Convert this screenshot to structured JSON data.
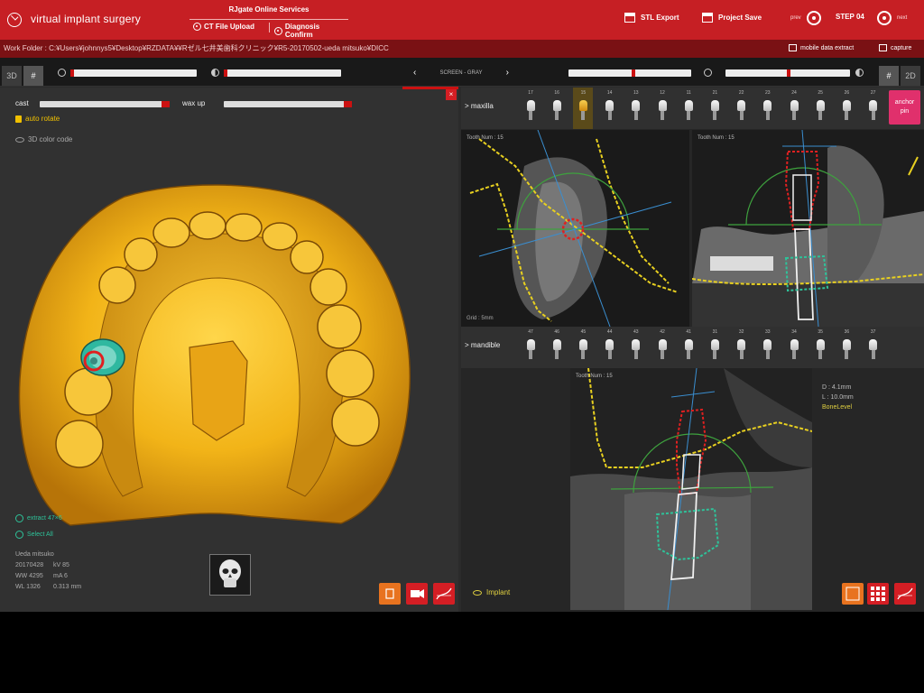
{
  "titlebar": {
    "app_title": "virtual implant surgery",
    "online_services_title": "RJgate Online Services",
    "ct_upload_label": "CT File Upload",
    "diagnosis_label": "Diagnosis Confirm",
    "stl_export_label": "STL Export",
    "project_save_label": "Project Save",
    "prev_label": "prev",
    "step_label": "STEP 04",
    "next_label": "next"
  },
  "workbar": {
    "path": "Work Folder : C:¥Users¥johnnys5¥Desktop¥RZDATA¥¥Rゼル七井美歯科クリニック¥R5-20170502-ueda mitsuko¥DICC",
    "mobile_label": "mobile data extract",
    "capture_label": "capture"
  },
  "toolbar": {
    "tab_3d": "3D",
    "tab_grid": "#",
    "tab_2d": "2D",
    "screen_label": "SCREEN - GRAY",
    "prev_arrow": "‹",
    "next_arrow": "›"
  },
  "left": {
    "cast_label": "cast",
    "wax_label": "wax up",
    "auto_rotate_label": "auto rotate",
    "color_code_label": "3D color code",
    "close_label": "×",
    "legend_1": "extract 47×6",
    "legend_2": "Select All",
    "patient": {
      "name": "Ueda mitsuko",
      "date": "20170428",
      "kv": "kV 85",
      "ww": "WW 4295",
      "ma": "mA 6",
      "wl": "WL 1326",
      "voxel": "0.313 mm"
    }
  },
  "right": {
    "maxilla_label": "> maxilla",
    "mandible_label": "> mandible",
    "anchor_label_1": "anchor",
    "anchor_label_2": "pin",
    "maxilla_teeth": [
      "17",
      "16",
      "15",
      "14",
      "13",
      "12",
      "11",
      "21",
      "22",
      "23",
      "24",
      "25",
      "26",
      "27"
    ],
    "mandible_teeth": [
      "47",
      "46",
      "45",
      "44",
      "43",
      "42",
      "41",
      "31",
      "32",
      "33",
      "34",
      "35",
      "36",
      "37"
    ],
    "selected_tooth": "15",
    "view_a_label": "Tooth Num : 15",
    "view_b_label": "Tooth Num : 15",
    "view_c_label": "Tooth Num : 15",
    "grid_label": "Grid : 5mm",
    "info_d": "D : 4.1mm",
    "info_l": "L : 10.0mm",
    "info_level": "BoneLevel",
    "implant_label": "Implant"
  },
  "colors": {
    "brand_red": "#c61f24",
    "dark_red": "#7a1114",
    "cast_yellow": "#f2b418",
    "implant_red": "#e02020",
    "bone_green": "#2ec39a",
    "nerve_yellow": "#e8d020",
    "anchor_pink": "#e0306c"
  }
}
